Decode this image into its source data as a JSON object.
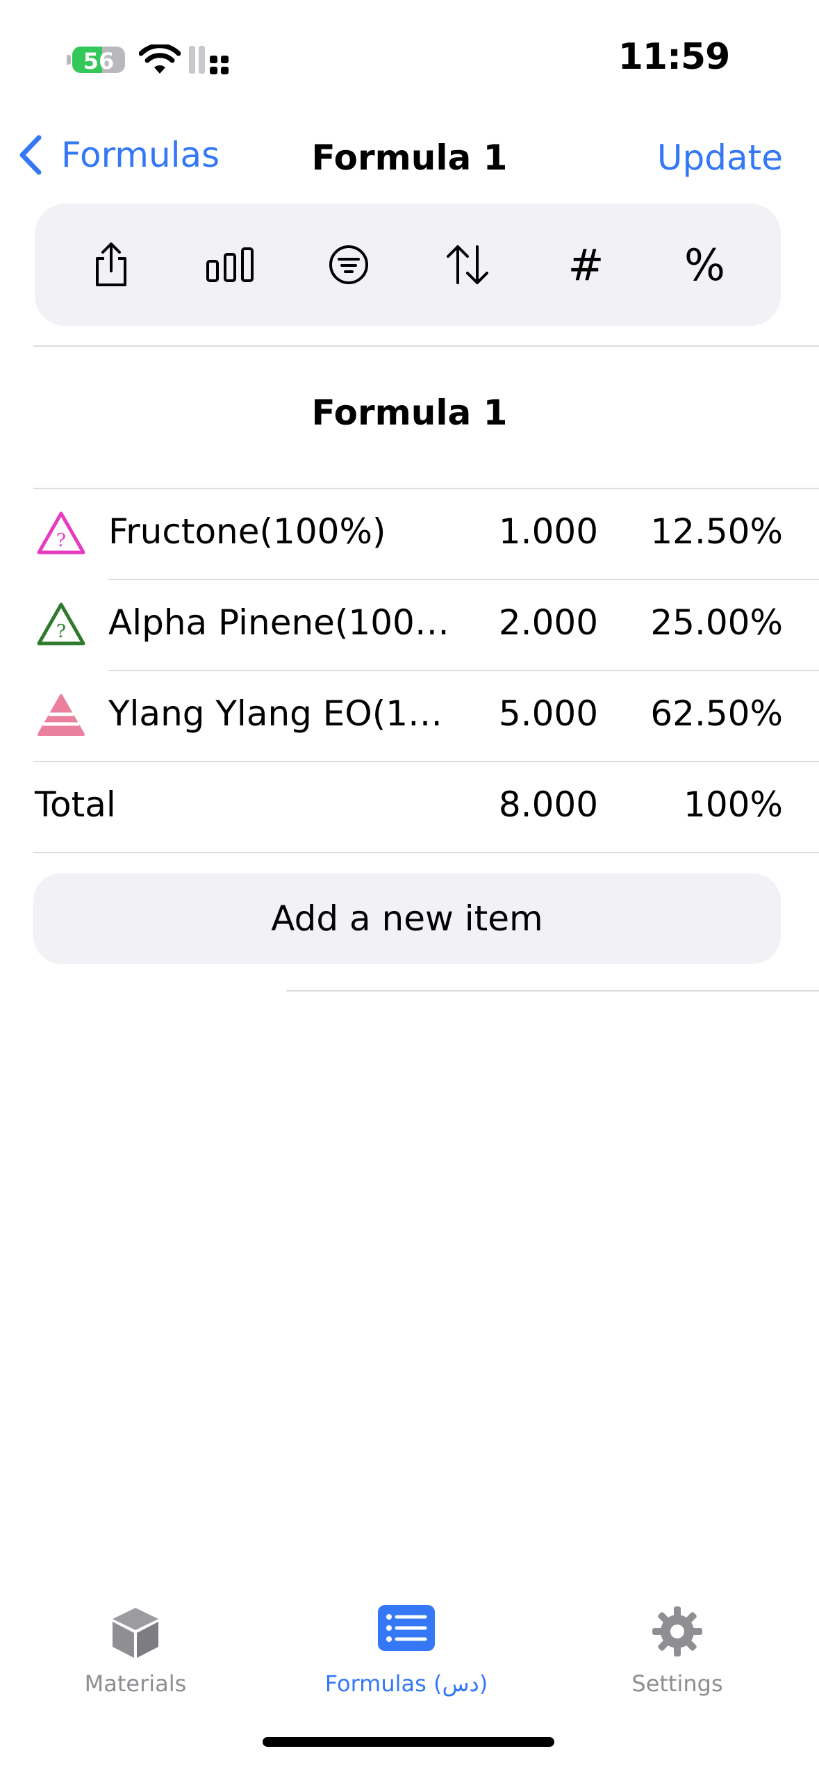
{
  "status": {
    "time": "11:59",
    "battery": "56",
    "battery_fraction": 0.56
  },
  "nav": {
    "back_label": "Formulas",
    "title": "Formula 1",
    "action_label": "Update"
  },
  "toolbar": {
    "icons": [
      "share-icon",
      "bar-chart-icon",
      "filter-icon",
      "sort-icon",
      "number-icon",
      "percent-icon"
    ],
    "number_glyph": "#",
    "percent_glyph": "%"
  },
  "section": {
    "title": "Formula 1"
  },
  "items": [
    {
      "name": "Fructone(100%)",
      "amount": "1.000",
      "percent": "12.50%",
      "icon": "warning-question-icon",
      "color": "#e63cc1"
    },
    {
      "name": "Alpha Pinene(100…",
      "amount": "2.000",
      "percent": "25.00%",
      "icon": "warning-question-icon",
      "color": "#2f7a2c"
    },
    {
      "name": "Ylang Ylang EO(1…",
      "amount": "5.000",
      "percent": "62.50%",
      "icon": "striped-triangle-icon",
      "color": "#ea7f9e"
    }
  ],
  "total": {
    "label": "Total",
    "amount": "8.000",
    "percent": "100%"
  },
  "add_button": "Add a new item",
  "tabs": [
    {
      "label": "Materials",
      "icon": "cube-icon",
      "active": false
    },
    {
      "label": "Formulas (دس)",
      "icon": "list-icon",
      "active": true
    },
    {
      "label": "Settings",
      "icon": "gear-icon",
      "active": false
    }
  ],
  "colors": {
    "accent": "#3478f6",
    "inactive": "#8e8e93",
    "panel": "#f1f1f6"
  }
}
